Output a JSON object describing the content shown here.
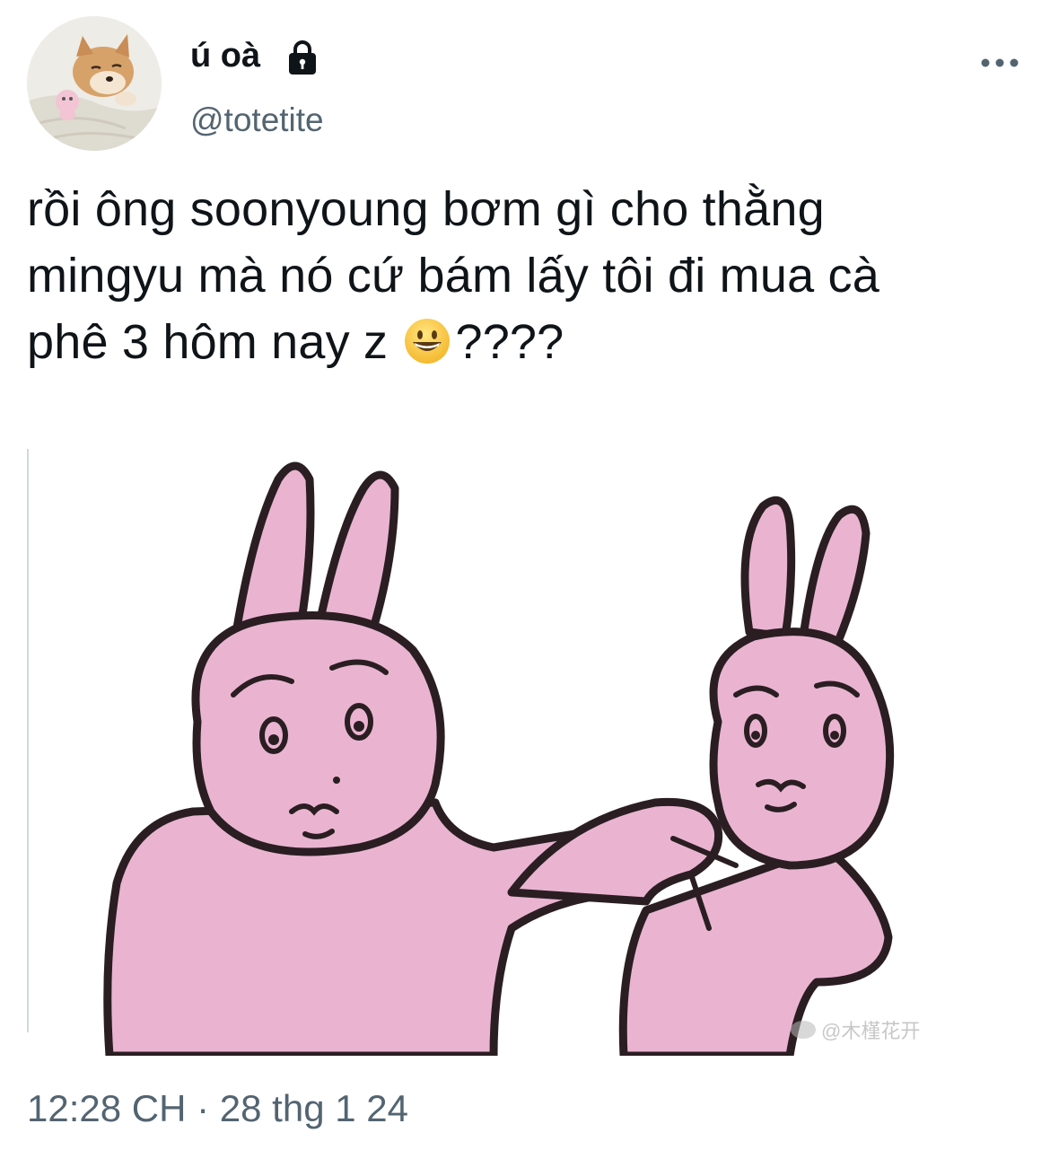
{
  "author": {
    "display_name": "ú oà",
    "handle": "@totetite",
    "avatar_icon": "shiba-dog-avatar",
    "protected_icon": "lock-icon"
  },
  "menu": {
    "icon": "more-horizontal-icon"
  },
  "tweet": {
    "lines": [
      "rồi ông soonyoung bơm gì cho thằng",
      "mingyu mà nó cứ bám lấy tôi đi mua cà",
      "phê 3 hôm nay z"
    ],
    "line3_suffix": "????",
    "emoji": "grinning-face-emoji"
  },
  "media": {
    "description_icon": "pink-rabbits-meme-image",
    "watermark": "@木槿花开"
  },
  "meta": {
    "time": "12:28 CH",
    "separator": "·",
    "date": "28 thg 1 24"
  },
  "colors": {
    "text_primary": "#0f1419",
    "text_secondary": "#536471",
    "rabbit_pink": "#eab4d1",
    "outline": "#2a1e22"
  }
}
